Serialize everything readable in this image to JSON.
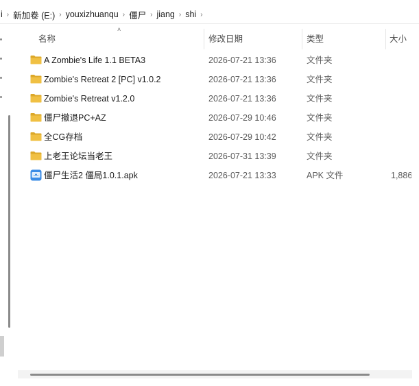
{
  "breadcrumb": {
    "first": "i",
    "items": [
      "新加卷 (E:)",
      "youxizhuanqu",
      "僵尸",
      "jiang",
      "shi"
    ]
  },
  "columns": {
    "name": "名称",
    "date": "修改日期",
    "type": "类型",
    "size": "大小"
  },
  "rows": [
    {
      "name": "A Zombie's Life 1.1 BETA3",
      "date": "2026-07-21 13:36",
      "type": "文件夹",
      "size": "",
      "icon": "folder-icon"
    },
    {
      "name": "Zombie's Retreat 2 [PC] v1.0.2",
      "date": "2026-07-21 13:36",
      "type": "文件夹",
      "size": "",
      "icon": "folder-icon"
    },
    {
      "name": "Zombie's Retreat v1.2.0",
      "date": "2026-07-21 13:36",
      "type": "文件夹",
      "size": "",
      "icon": "folder-icon"
    },
    {
      "name": "僵尸撤退PC+AZ",
      "date": "2026-07-29 10:46",
      "type": "文件夹",
      "size": "",
      "icon": "folder-icon"
    },
    {
      "name": "全CG存档",
      "date": "2026-07-29 10:42",
      "type": "文件夹",
      "size": "",
      "icon": "folder-icon"
    },
    {
      "name": "上老王论坛当老王",
      "date": "2026-07-31 13:39",
      "type": "文件夹",
      "size": "",
      "icon": "folder-icon"
    },
    {
      "name": "僵尸生活2 僵局1.0.1.apk",
      "date": "2026-07-21 13:33",
      "type": "APK 文件",
      "size": "1,886",
      "icon": "apk-icon"
    }
  ],
  "colors": {
    "folder": "#f0c043",
    "folder_dark": "#dca829",
    "apk": "#3c8ce6"
  }
}
